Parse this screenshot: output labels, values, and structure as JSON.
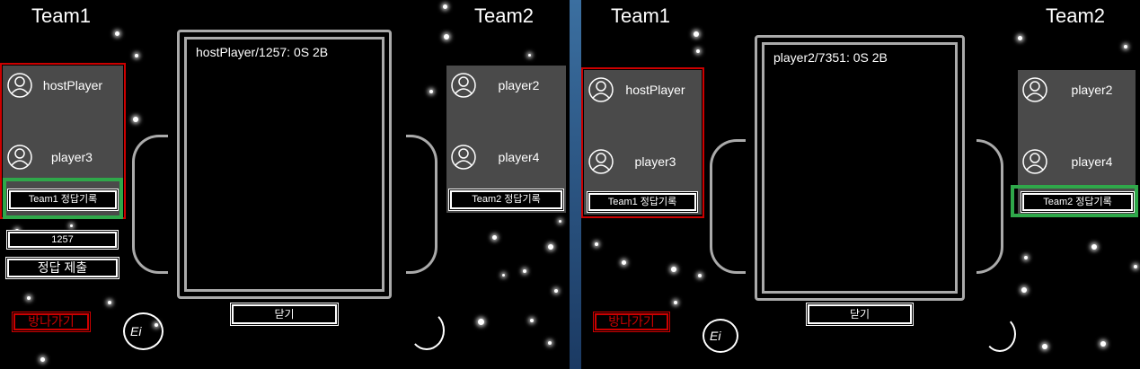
{
  "left": {
    "team1_title": "Team1",
    "team2_title": "Team2",
    "team1_players": [
      "hostPlayer",
      "player3"
    ],
    "team2_players": [
      "player2",
      "player4"
    ],
    "team1_record_label": "Team1 정답기록",
    "team2_record_label": "Team2 정답기록",
    "answer_input_value": "1257",
    "submit_label": "정답 제출",
    "leave_label": "방나가기",
    "exit_partial": "Ei",
    "modal_text": "hostPlayer/1257: 0S 2B",
    "close_label": "닫기"
  },
  "right": {
    "team1_title": "Team1",
    "team2_title": "Team2",
    "team1_players": [
      "hostPlayer",
      "player3"
    ],
    "team2_players": [
      "player2",
      "player4"
    ],
    "team1_record_label": "Team1 정답기록",
    "team2_record_label": "Team2 정답기록",
    "leave_label": "방나가기",
    "exit_partial": "Ei",
    "modal_text": "player2/7351: 0S 2B",
    "close_label": "닫기"
  },
  "icons": {
    "avatar": "user-avatar-icon"
  },
  "colors": {
    "highlight_red": "#cc0000",
    "highlight_green": "#2fa84a",
    "panel_gray": "#4a4a4a"
  }
}
